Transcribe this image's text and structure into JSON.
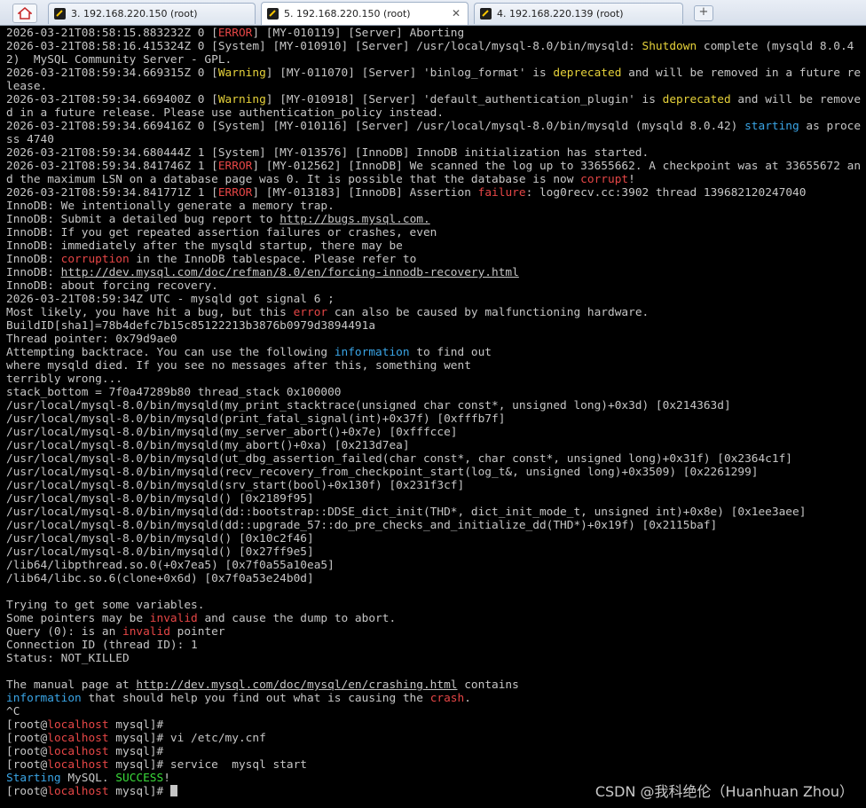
{
  "tabs": [
    {
      "label": "3. 192.168.220.150 (root)"
    },
    {
      "label": "5. 192.168.220.150 (root)"
    },
    {
      "label": "4. 192.168.220.139 (root)"
    }
  ],
  "terminal": {
    "lines": [
      [
        [
          "2026-03-21T08:58:15.883232Z 0 [",
          ""
        ],
        [
          "ERROR",
          "r"
        ],
        [
          "] [MY-010119] [Server] Aborting",
          ""
        ]
      ],
      [
        [
          "2026-03-21T08:58:16.415324Z 0 [System] [MY-010910] [Server] /usr/local/mysql-8.0/bin/mysqld: ",
          ""
        ],
        [
          "Shutdown",
          "y"
        ],
        [
          " complete (mysqld 8.0.42)  MySQL Community Server - GPL.",
          ""
        ]
      ],
      [
        [
          "2026-03-21T08:59:34.669315Z 0 [",
          ""
        ],
        [
          "Warning",
          "y"
        ],
        [
          "] [MY-011070] [Server] 'binlog_format' is ",
          ""
        ],
        [
          "deprecated",
          "y"
        ],
        [
          " and will be removed in a future release.",
          ""
        ]
      ],
      [
        [
          "2026-03-21T08:59:34.669400Z 0 [",
          ""
        ],
        [
          "Warning",
          "y"
        ],
        [
          "] [MY-010918] [Server] 'default_authentication_plugin' is ",
          ""
        ],
        [
          "deprecated",
          "y"
        ],
        [
          " and will be removed in a future release. Please use authentication_policy instead.",
          ""
        ]
      ],
      [
        [
          "2026-03-21T08:59:34.669416Z 0 [System] [MY-010116] [Server] /usr/local/mysql-8.0/bin/mysqld (mysqld 8.0.42) ",
          ""
        ],
        [
          "starting",
          "b"
        ],
        [
          " as process 4740",
          ""
        ]
      ],
      [
        [
          "2026-03-21T08:59:34.680444Z 1 [System] [MY-013576] [InnoDB] InnoDB initialization has started.",
          ""
        ]
      ],
      [
        [
          "2026-03-21T08:59:34.841746Z 1 [",
          ""
        ],
        [
          "ERROR",
          "r"
        ],
        [
          "] [MY-012562] [InnoDB] We scanned the log up to 33655662. A checkpoint was at 33655672 and the maximum LSN on a database page was 0. It is possible that the database is now ",
          ""
        ],
        [
          "corrupt",
          "r"
        ],
        [
          "!",
          ""
        ]
      ],
      [
        [
          "2026-03-21T08:59:34.841771Z 1 [",
          ""
        ],
        [
          "ERROR",
          "r"
        ],
        [
          "] [MY-013183] [InnoDB] Assertion ",
          ""
        ],
        [
          "failure",
          "r"
        ],
        [
          ": log0recv.cc:3902 thread 139682120247040",
          ""
        ]
      ],
      [
        [
          "InnoDB: We intentionally generate a memory trap.",
          ""
        ]
      ],
      [
        [
          "InnoDB: Submit a detailed bug report to ",
          ""
        ],
        [
          "http://bugs.mysql.com.",
          "u"
        ]
      ],
      [
        [
          "InnoDB: If you get repeated assertion failures or crashes, even",
          ""
        ]
      ],
      [
        [
          "InnoDB: immediately after the mysqld startup, there may be",
          ""
        ]
      ],
      [
        [
          "InnoDB: ",
          ""
        ],
        [
          "corruption",
          "r"
        ],
        [
          " in the InnoDB tablespace. Please refer to",
          ""
        ]
      ],
      [
        [
          "InnoDB: ",
          ""
        ],
        [
          "http://dev.mysql.com/doc/refman/8.0/en/forcing-innodb-recovery.html",
          "u"
        ]
      ],
      [
        [
          "InnoDB: about forcing recovery.",
          ""
        ]
      ],
      [
        [
          "2026-03-21T08:59:34Z UTC - mysqld got signal 6 ;",
          ""
        ]
      ],
      [
        [
          "Most likely, you have hit a bug, but this ",
          ""
        ],
        [
          "error",
          "r"
        ],
        [
          " can also be caused by malfunctioning hardware.",
          ""
        ]
      ],
      [
        [
          "BuildID[sha1]=78b4defc7b15c85122213b3876b0979d3894491a",
          ""
        ]
      ],
      [
        [
          "Thread pointer: 0x79d9ae0",
          ""
        ]
      ],
      [
        [
          "Attempting backtrace. You can use the following ",
          ""
        ],
        [
          "information",
          "b"
        ],
        [
          " to find out",
          ""
        ]
      ],
      [
        [
          "where mysqld died. If you see no messages after this, something went",
          ""
        ]
      ],
      [
        [
          "terribly wrong...",
          ""
        ]
      ],
      [
        [
          "stack_bottom = 7f0a47289b80 thread_stack 0x100000",
          ""
        ]
      ],
      [
        [
          "/usr/local/mysql-8.0/bin/mysqld(my_print_stacktrace(unsigned char const*, unsigned long)+0x3d) [0x214363d]",
          ""
        ]
      ],
      [
        [
          "/usr/local/mysql-8.0/bin/mysqld(print_fatal_signal(int)+0x37f) [0xfffb7f]",
          ""
        ]
      ],
      [
        [
          "/usr/local/mysql-8.0/bin/mysqld(my_server_abort()+0x7e) [0xfffcce]",
          ""
        ]
      ],
      [
        [
          "/usr/local/mysql-8.0/bin/mysqld(my_abort()+0xa) [0x213d7ea]",
          ""
        ]
      ],
      [
        [
          "/usr/local/mysql-8.0/bin/mysqld(ut_dbg_assertion_failed(char const*, char const*, unsigned long)+0x31f) [0x2364c1f]",
          ""
        ]
      ],
      [
        [
          "/usr/local/mysql-8.0/bin/mysqld(recv_recovery_from_checkpoint_start(log_t&, unsigned long)+0x3509) [0x2261299]",
          ""
        ]
      ],
      [
        [
          "/usr/local/mysql-8.0/bin/mysqld(srv_start(bool)+0x130f) [0x231f3cf]",
          ""
        ]
      ],
      [
        [
          "/usr/local/mysql-8.0/bin/mysqld() [0x2189f95]",
          ""
        ]
      ],
      [
        [
          "/usr/local/mysql-8.0/bin/mysqld(dd::bootstrap::DDSE_dict_init(THD*, dict_init_mode_t, unsigned int)+0x8e) [0x1ee3aee]",
          ""
        ]
      ],
      [
        [
          "/usr/local/mysql-8.0/bin/mysqld(dd::upgrade_57::do_pre_checks_and_initialize_dd(THD*)+0x19f) [0x2115baf]",
          ""
        ]
      ],
      [
        [
          "/usr/local/mysql-8.0/bin/mysqld() [0x10c2f46]",
          ""
        ]
      ],
      [
        [
          "/usr/local/mysql-8.0/bin/mysqld() [0x27ff9e5]",
          ""
        ]
      ],
      [
        [
          "/lib64/libpthread.so.0(+0x7ea5) [0x7f0a55a10ea5]",
          ""
        ]
      ],
      [
        [
          "/lib64/libc.so.6(clone+0x6d) [0x7f0a53e24b0d]",
          ""
        ]
      ],
      [
        [
          "",
          ""
        ]
      ],
      [
        [
          "Trying to get some variables.",
          ""
        ]
      ],
      [
        [
          "Some pointers may be ",
          ""
        ],
        [
          "invalid",
          "r"
        ],
        [
          " and cause the dump to abort.",
          ""
        ]
      ],
      [
        [
          "Query (0): is an ",
          ""
        ],
        [
          "invalid",
          "r"
        ],
        [
          " pointer",
          ""
        ]
      ],
      [
        [
          "Connection ID (thread ID): 1",
          ""
        ]
      ],
      [
        [
          "Status: NOT_KILLED",
          ""
        ]
      ],
      [
        [
          "",
          ""
        ]
      ],
      [
        [
          "The manual page at ",
          ""
        ],
        [
          "http://dev.mysql.com/doc/mysql/en/crashing.html",
          "u"
        ],
        [
          " contains",
          ""
        ]
      ],
      [
        [
          "information",
          "b"
        ],
        [
          " that should help you find out what is causing the ",
          ""
        ],
        [
          "crash",
          "r"
        ],
        [
          ".",
          ""
        ]
      ],
      [
        [
          "^C",
          ""
        ]
      ],
      [
        [
          "[root@",
          ""
        ],
        [
          "localhost",
          "r"
        ],
        [
          " mysql]#",
          ""
        ]
      ],
      [
        [
          "[root@",
          ""
        ],
        [
          "localhost",
          "r"
        ],
        [
          " mysql]# vi /etc/my.cnf",
          ""
        ]
      ],
      [
        [
          "[root@",
          ""
        ],
        [
          "localhost",
          "r"
        ],
        [
          " mysql]#",
          ""
        ]
      ],
      [
        [
          "[root@",
          ""
        ],
        [
          "localhost",
          "r"
        ],
        [
          " mysql]# service  mysql start",
          ""
        ]
      ],
      [
        [
          "Starting",
          "b"
        ],
        [
          " MySQL. ",
          ""
        ],
        [
          "SUCCESS",
          "g"
        ],
        [
          "!",
          ""
        ]
      ],
      [
        [
          "[root@",
          ""
        ],
        [
          "localhost",
          "r"
        ],
        [
          " mysql]# ",
          ""
        ]
      ]
    ]
  },
  "watermark": "CSDN @我科绝伦（Huanhuan Zhou）"
}
